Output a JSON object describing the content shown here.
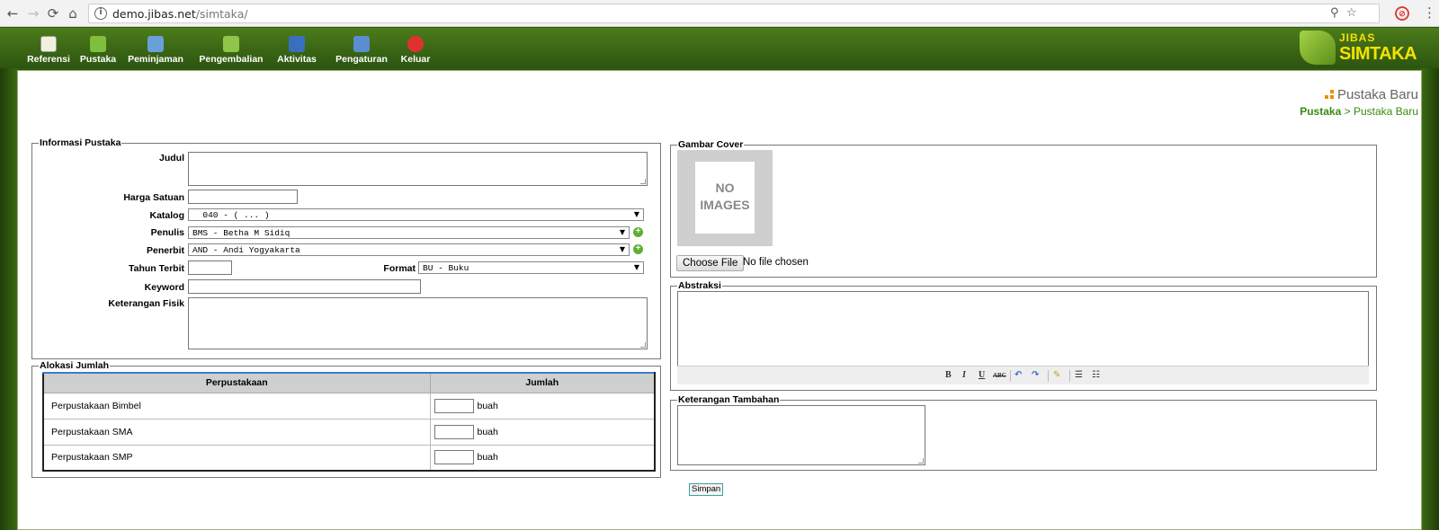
{
  "browser": {
    "url_host": "demo.jibas.net",
    "url_path": "/simtaka/"
  },
  "nav": {
    "items": [
      {
        "label": "Referensi",
        "color": "#e8e8d0"
      },
      {
        "label": "Pustaka",
        "color": "#7fbf3f"
      },
      {
        "label": "Peminjaman",
        "color": "#6aa0d8"
      },
      {
        "label": "Pengembalian",
        "color": "#8fc64a"
      },
      {
        "label": "Aktivitas",
        "color": "#3a6fc0"
      },
      {
        "label": "Pengaturan",
        "color": "#5a8ed0"
      },
      {
        "label": "Keluar",
        "color": "#e03030"
      }
    ]
  },
  "logo": {
    "top": "JIBAS",
    "bottom": "SIMTAKA"
  },
  "page": {
    "title": "Pustaka Baru",
    "breadcrumb_root": "Pustaka",
    "breadcrumb_sep": ">",
    "breadcrumb_current": "Pustaka Baru"
  },
  "info": {
    "legend": "Informasi Pustaka",
    "judul_label": "Judul",
    "harga_label": "Harga Satuan",
    "katalog_label": "Katalog",
    "katalog_value": "  040 - ( ... )",
    "penulis_label": "Penulis",
    "penulis_value": "BMS - Betha M Sidiq",
    "penerbit_label": "Penerbit",
    "penerbit_value": "AND - Andi Yogyakarta",
    "tahun_label": "Tahun Terbit",
    "format_label": "Format",
    "format_value": "BU - Buku",
    "keyword_label": "Keyword",
    "keterangan_label": "Keterangan Fisik"
  },
  "alokasi": {
    "legend": "Alokasi Jumlah",
    "col_perpus": "Perpustakaan",
    "col_jumlah": "Jumlah",
    "unit": "buah",
    "rows": [
      "Perpustakaan Bimbel",
      "Perpustakaan SMA",
      "Perpustakaan SMP"
    ]
  },
  "cover": {
    "legend": "Gambar Cover",
    "noimg_1": "NO",
    "noimg_2": "IMAGES",
    "choose_label": "Choose File",
    "no_file": "No file chosen"
  },
  "abstraksi": {
    "legend": "Abstraksi"
  },
  "tambahan": {
    "legend": "Keterangan Tambahan"
  },
  "submit_label": "Simpan"
}
